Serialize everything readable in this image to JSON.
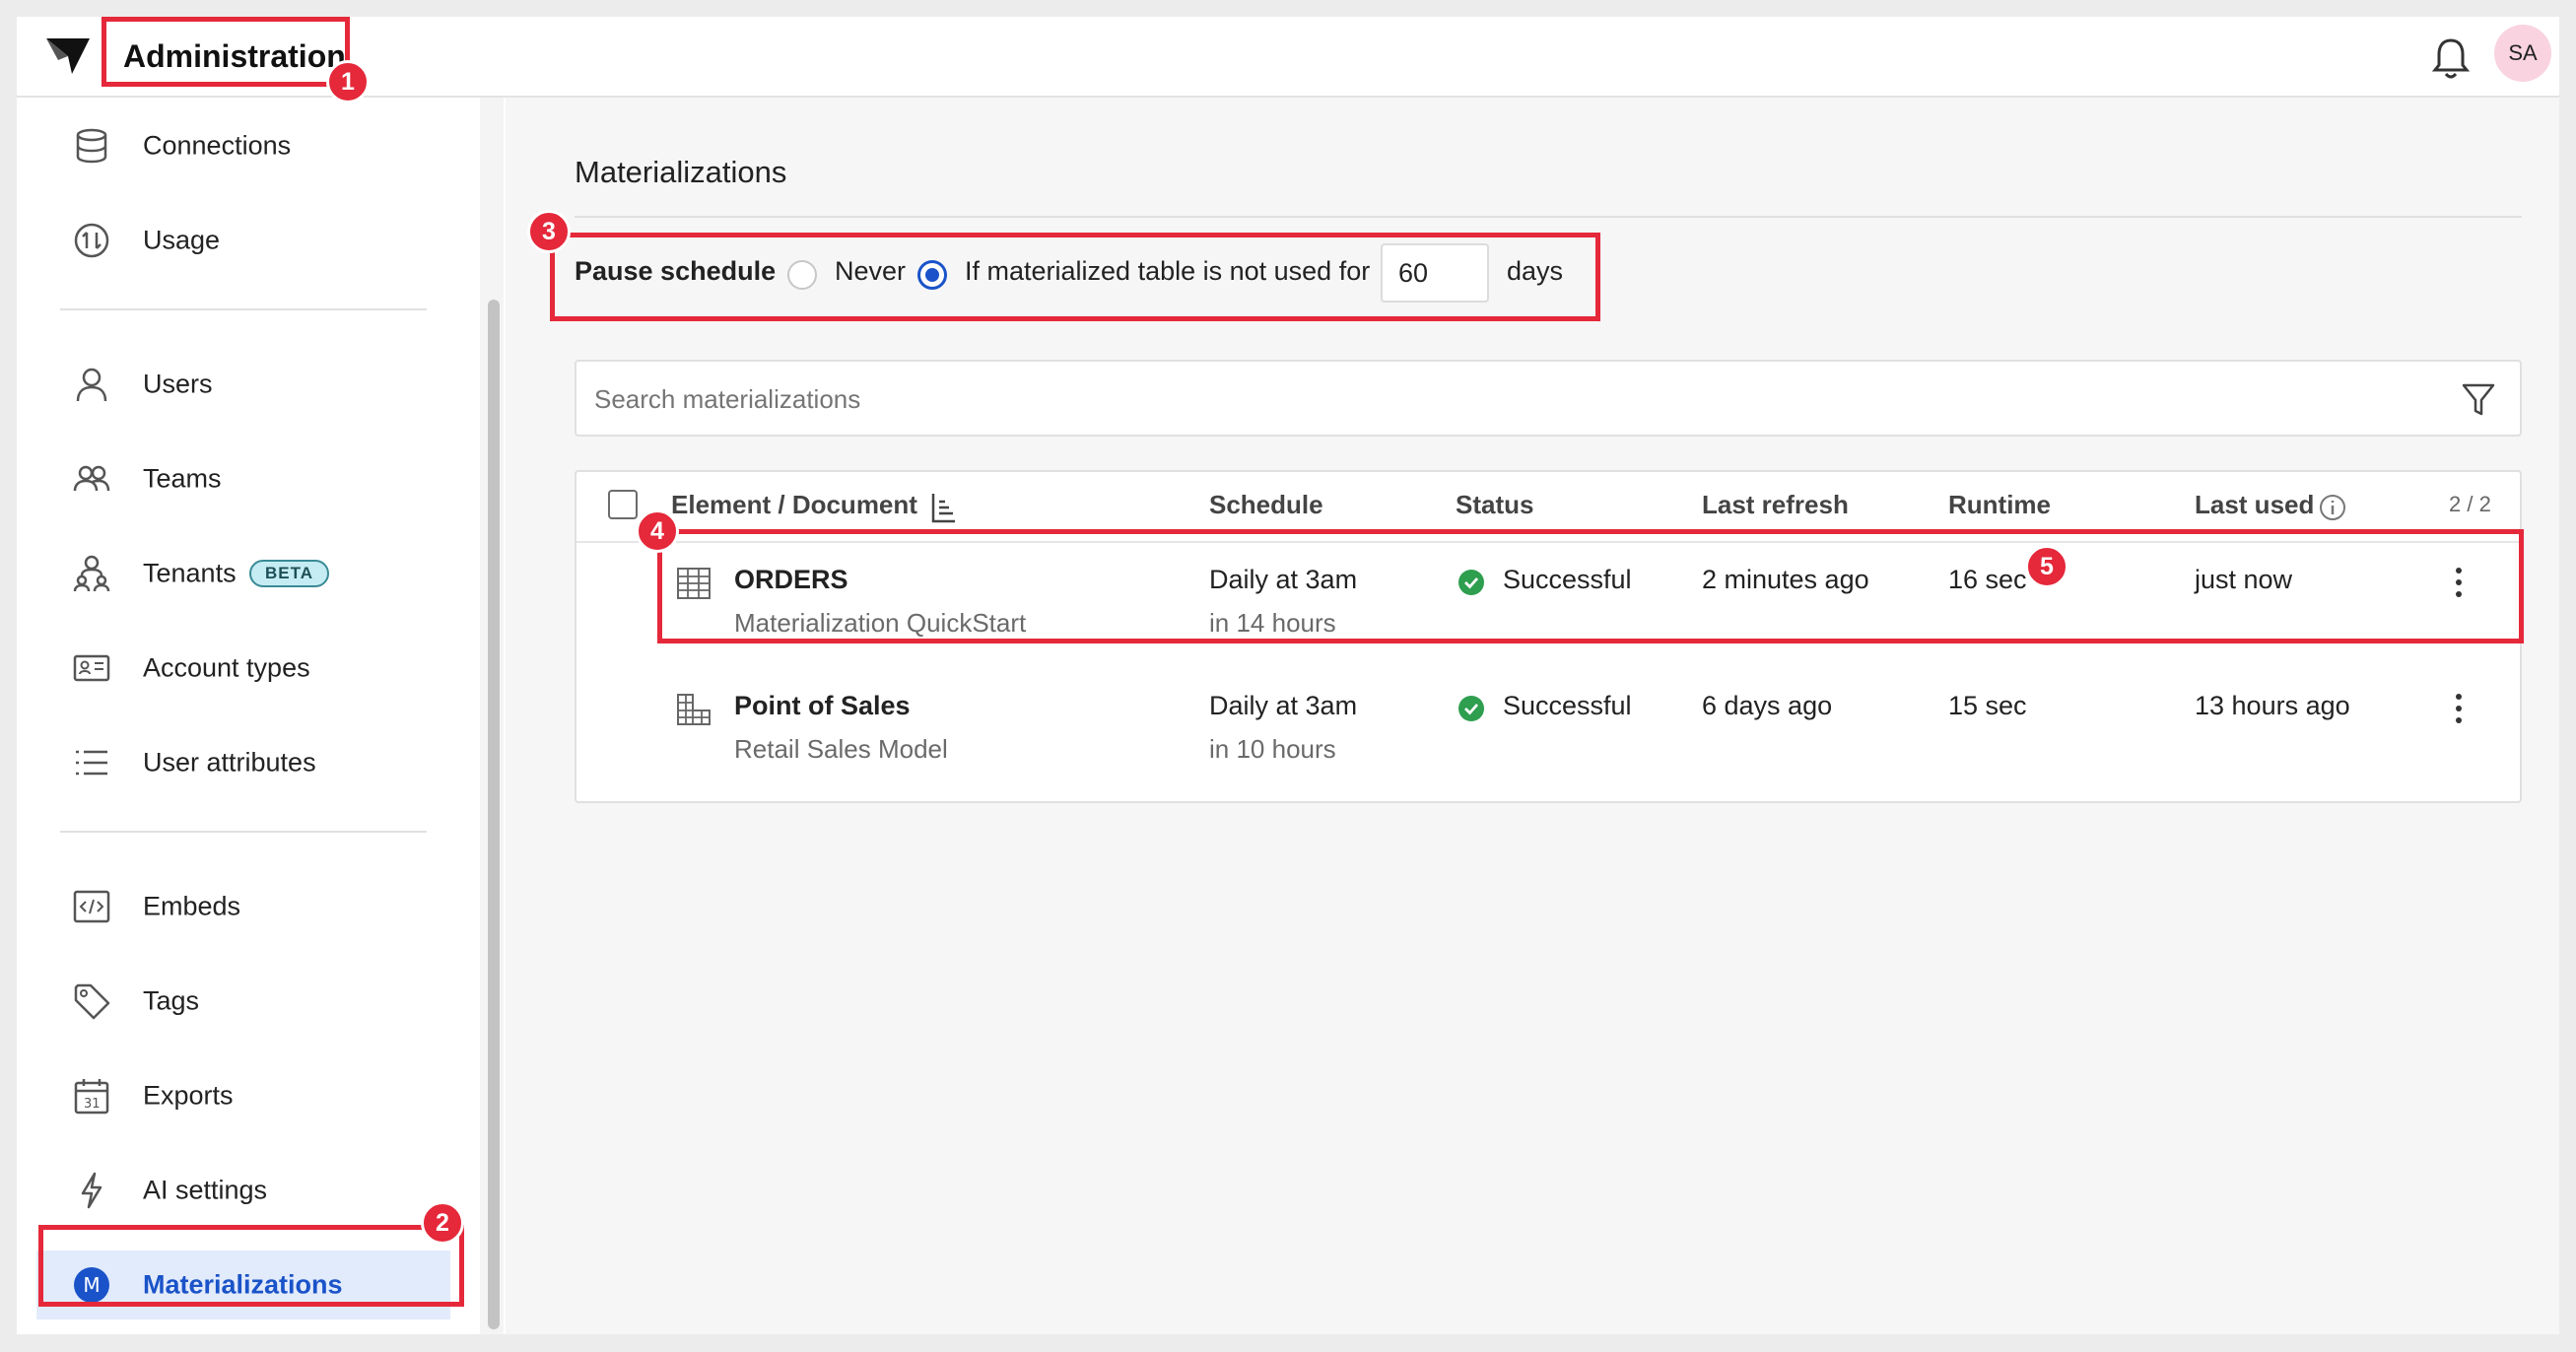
{
  "header": {
    "title": "Administration",
    "avatar_initials": "SA"
  },
  "sidebar": {
    "items": [
      {
        "label": "Connections",
        "icon": "database-icon"
      },
      {
        "label": "Usage",
        "icon": "usage-icon"
      },
      {
        "label": "Users",
        "icon": "user-icon"
      },
      {
        "label": "Teams",
        "icon": "team-icon"
      },
      {
        "label": "Tenants",
        "icon": "tenants-icon",
        "badge": "BETA"
      },
      {
        "label": "Account types",
        "icon": "id-card-icon"
      },
      {
        "label": "User attributes",
        "icon": "list-icon"
      },
      {
        "label": "Embeds",
        "icon": "code-icon"
      },
      {
        "label": "Tags",
        "icon": "tag-icon"
      },
      {
        "label": "Exports",
        "icon": "calendar-icon"
      },
      {
        "label": "AI settings",
        "icon": "lightning-icon"
      },
      {
        "label": "Materializations",
        "icon": "materializations-icon",
        "active": true,
        "icon_letter": "M"
      }
    ]
  },
  "main": {
    "title": "Materializations",
    "pause_schedule": {
      "label": "Pause schedule",
      "option_never": "Never",
      "option_unused": "If materialized table is not used for",
      "selected": "unused",
      "days_value": "60",
      "days_suffix": "days"
    },
    "search": {
      "placeholder": "Search materializations"
    },
    "table": {
      "columns": [
        "Element / Document",
        "Schedule",
        "Status",
        "Last refresh",
        "Runtime",
        "Last used"
      ],
      "count": "2 / 2",
      "rows": [
        {
          "element": "ORDERS",
          "document": "Materialization QuickStart",
          "schedule": "Daily at 3am",
          "schedule_next": "in 14 hours",
          "status": "Successful",
          "last_refresh": "2 minutes ago",
          "runtime": "16 sec",
          "last_used": "just now",
          "icon": "table-icon"
        },
        {
          "element": "Point of Sales",
          "document": "Retail Sales Model",
          "schedule": "Daily at 3am",
          "schedule_next": "in 10 hours",
          "status": "Successful",
          "last_refresh": "6 days ago",
          "runtime": "15 sec",
          "last_used": "13 hours ago",
          "icon": "pivot-table-icon"
        }
      ]
    }
  },
  "annotations": [
    "1",
    "2",
    "3",
    "4",
    "5"
  ],
  "colors": {
    "accent": "#1a53c9",
    "annotation": "#e5283a",
    "success": "#2e9e4f",
    "active_bg": "#e2ebfb"
  }
}
